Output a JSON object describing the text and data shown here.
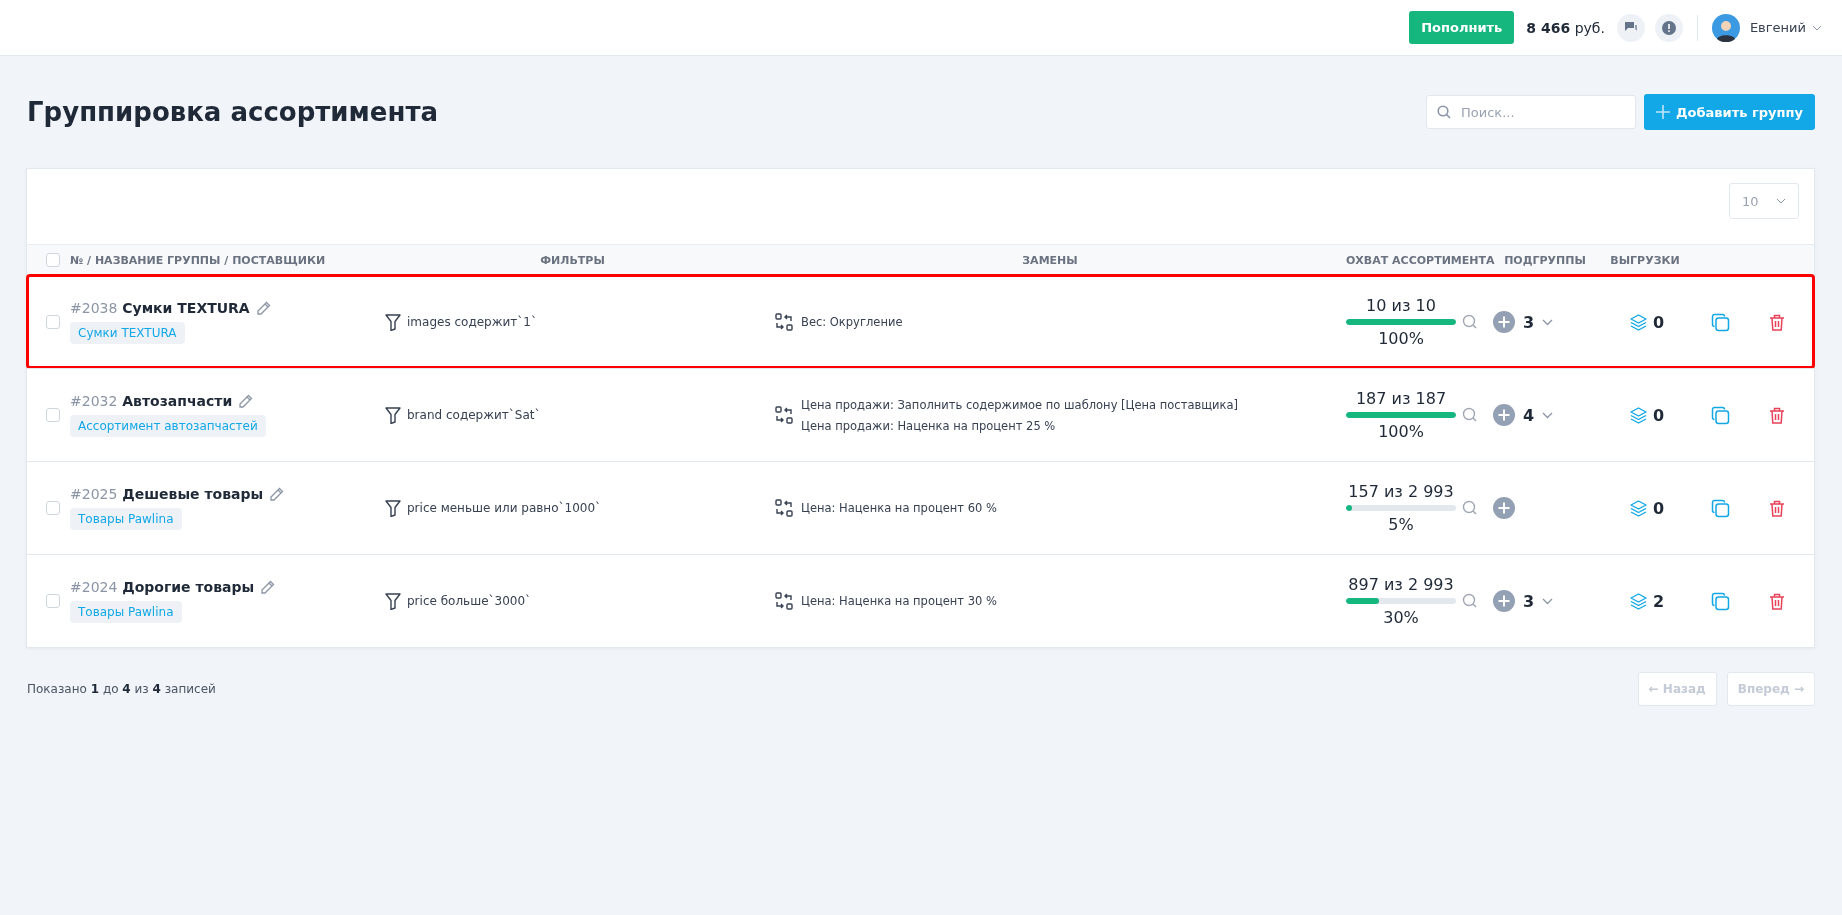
{
  "topbar": {
    "topup_button": "Пополнить",
    "balance": "8 466",
    "currency": "руб.",
    "user_name": "Евгений"
  },
  "page": {
    "title": "Группировка ассортимента",
    "search": {
      "placeholder": "Поиск..."
    },
    "add_button": "Добавить группу"
  },
  "table": {
    "page_size": "10",
    "select_all": {
      "checked": false
    },
    "columns": [
      "№ / НАЗВАНИЕ ГРУППЫ / ПОСТАВЩИКИ",
      "ФИЛЬТРЫ",
      "ЗАМЕНЫ",
      "ОХВАТ АССОРТИМЕНТА",
      "ПОДГРУППЫ",
      "ВЫГРУЗКИ"
    ],
    "rows": [
      {
        "checked": false,
        "highlighted": true,
        "id": "#2038",
        "name": "Сумки TEXTURA",
        "supplier": "Сумки TEXTURA",
        "filter": "images содержит`1`",
        "replacements": [
          "Вес: Округление"
        ],
        "coverage": "10 из 10",
        "level": 1,
        "percent": "100%",
        "subgroups": "3",
        "exports": "0"
      },
      {
        "checked": false,
        "highlighted": false,
        "id": "#2032",
        "name": "Автозапчасти",
        "supplier": "Ассортимент автозапчастей",
        "filter": "brand содержит`Sat`",
        "replacements": [
          "Цена продажи: Заполнить содержимое по шаблону [Цена поставщика]",
          "Цена продажи: Наценка на процент 25 %"
        ],
        "coverage": "187 из 187",
        "level": 1,
        "percent": "100%",
        "subgroups": "4",
        "exports": "0"
      },
      {
        "checked": false,
        "highlighted": false,
        "id": "#2025",
        "name": "Дешевые товары",
        "supplier": "Товары Pawlina",
        "filter": "price меньше или равно`1000`",
        "replacements": [
          "Цена: Наценка на процент 60 %"
        ],
        "coverage": "157 из 2 993",
        "level": 0.05,
        "percent": "5%",
        "exports": "0"
      },
      {
        "checked": false,
        "highlighted": false,
        "id": "#2024",
        "name": "Дорогие товары",
        "supplier": "Товары Pawlina",
        "filter": "price больше`3000`",
        "replacements": [
          "Цена: Наценка на процент 30 %"
        ],
        "coverage": "897 из 2 993",
        "level": 0.3,
        "percent": "30%",
        "subgroups": "3",
        "exports": "2"
      }
    ]
  },
  "footer": {
    "summary": "Показано **1** до **4** из **4** записей",
    "prev": {
      "label": "← Назад",
      "disabled": true
    },
    "next": {
      "label": "Вперед →",
      "disabled": true
    }
  }
}
